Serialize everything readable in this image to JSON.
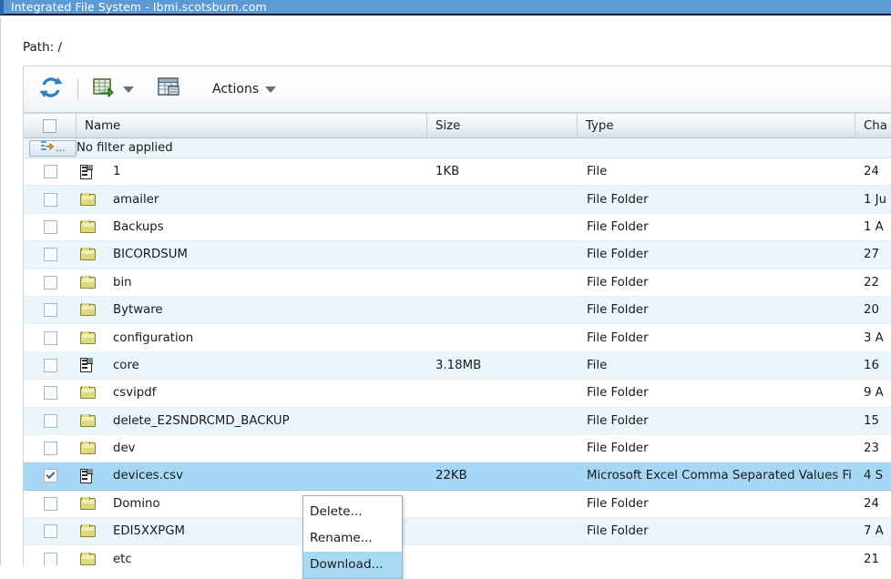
{
  "window": {
    "title": "Integrated File System - Ibmi.scotsburn.com",
    "title_bar_color": "#5b9bd5"
  },
  "path": {
    "label": "Path:",
    "value": "/",
    "full": "Path: /"
  },
  "toolbar": {
    "refresh_icon": "refresh-icon",
    "upload_icon": "upload-file-icon",
    "upload_caret": "chevron-down-icon",
    "columns_icon": "table-columns-icon",
    "actions_label": "Actions",
    "actions_caret": "chevron-down-icon"
  },
  "grid": {
    "columns": [
      {
        "key": "check",
        "label": ""
      },
      {
        "key": "name",
        "label": "Name"
      },
      {
        "key": "size",
        "label": "Size"
      },
      {
        "key": "type",
        "label": "Type"
      },
      {
        "key": "changed",
        "label": "Cha"
      }
    ],
    "filter_row": {
      "button_icon": "filter-icon",
      "button_dots": "...",
      "text": "No filter applied"
    },
    "header_select_all": "select-all-checkbox",
    "rows": [
      {
        "name": "1",
        "icon": "file-icon",
        "size": "1KB",
        "type": "File",
        "changed": "24 ",
        "checked": false,
        "selected": false
      },
      {
        "name": "amailer",
        "icon": "folder-icon",
        "size": "",
        "type": "File Folder",
        "changed": "1 Ju",
        "checked": false,
        "selected": false
      },
      {
        "name": "Backups",
        "icon": "folder-icon",
        "size": "",
        "type": "File Folder",
        "changed": "1 A",
        "checked": false,
        "selected": false
      },
      {
        "name": "BICORDSUM",
        "icon": "folder-icon",
        "size": "",
        "type": "File Folder",
        "changed": "27 ",
        "checked": false,
        "selected": false
      },
      {
        "name": "bin",
        "icon": "folder-icon",
        "size": "",
        "type": "File Folder",
        "changed": "22 ",
        "checked": false,
        "selected": false
      },
      {
        "name": "Bytware",
        "icon": "folder-icon",
        "size": "",
        "type": "File Folder",
        "changed": "20 ",
        "checked": false,
        "selected": false
      },
      {
        "name": "configuration",
        "icon": "folder-icon",
        "size": "",
        "type": "File Folder",
        "changed": "3 A",
        "checked": false,
        "selected": false
      },
      {
        "name": "core",
        "icon": "file-icon",
        "size": "3.18MB",
        "type": "File",
        "changed": "16 ",
        "checked": false,
        "selected": false
      },
      {
        "name": "csvipdf",
        "icon": "folder-icon",
        "size": "",
        "type": "File Folder",
        "changed": "9 A",
        "checked": false,
        "selected": false
      },
      {
        "name": "delete_E2SNDRCMD_BACKUP",
        "icon": "folder-icon",
        "size": "",
        "type": "File Folder",
        "changed": "15 ",
        "checked": false,
        "selected": false
      },
      {
        "name": "dev",
        "icon": "folder-icon",
        "size": "",
        "type": "File Folder",
        "changed": "23 ",
        "checked": false,
        "selected": false
      },
      {
        "name": "devices.csv",
        "icon": "file-icon",
        "size": "22KB",
        "type": "Microsoft Excel Comma Separated Values Fi",
        "changed": "4 S",
        "checked": true,
        "selected": true
      },
      {
        "name": "Domino",
        "icon": "folder-icon",
        "size": "",
        "type": "File Folder",
        "changed": "24 ",
        "checked": false,
        "selected": false
      },
      {
        "name": "EDI5XXPGM",
        "icon": "folder-icon",
        "size": "",
        "type": "File Folder",
        "changed": "7 A",
        "checked": false,
        "selected": false
      },
      {
        "name": "etc",
        "icon": "folder-icon",
        "size": "",
        "type": "",
        "changed": "21 ",
        "checked": false,
        "selected": false
      }
    ]
  },
  "context_menu": {
    "items": [
      {
        "label": "Delete...",
        "highlighted": false
      },
      {
        "label": "Rename...",
        "highlighted": false
      },
      {
        "label": "Download...",
        "highlighted": true
      }
    ]
  },
  "colors": {
    "title_bar": "#5b9bd5",
    "row_alt": "#eaf5fc",
    "row_selected": "#a6d8f5",
    "menu_highlight": "#a8d9f4",
    "folder": "#dcd97e"
  }
}
